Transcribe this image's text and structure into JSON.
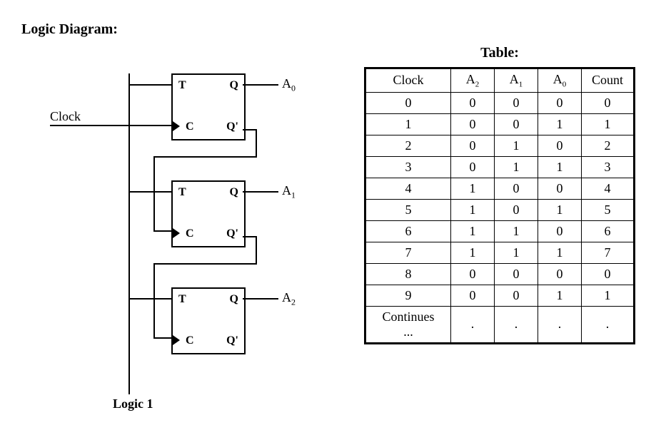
{
  "headings": {
    "diagram": "Logic Diagram:",
    "table": "Table:"
  },
  "diagram": {
    "clock_label": "Clock",
    "logic1_label": "Logic 1",
    "ff_pins": {
      "T": "T",
      "Q": "Q",
      "C": "C",
      "Qn": "Q'"
    },
    "outputs": {
      "A0": "A",
      "A0sub": "0",
      "A1": "A",
      "A1sub": "1",
      "A2": "A",
      "A2sub": "2"
    }
  },
  "table": {
    "headers": {
      "clock": "Clock",
      "A2": "A",
      "A2sub": "2",
      "A1": "A",
      "A1sub": "1",
      "A0": "A",
      "A0sub": "0",
      "count": "Count"
    },
    "rows": [
      {
        "clock": "0",
        "a2": "0",
        "a1": "0",
        "a0": "0",
        "count": "0"
      },
      {
        "clock": "1",
        "a2": "0",
        "a1": "0",
        "a0": "1",
        "count": "1"
      },
      {
        "clock": "2",
        "a2": "0",
        "a1": "1",
        "a0": "0",
        "count": "2"
      },
      {
        "clock": "3",
        "a2": "0",
        "a1": "1",
        "a0": "1",
        "count": "3"
      },
      {
        "clock": "4",
        "a2": "1",
        "a1": "0",
        "a0": "0",
        "count": "4"
      },
      {
        "clock": "5",
        "a2": "1",
        "a1": "0",
        "a0": "1",
        "count": "5"
      },
      {
        "clock": "6",
        "a2": "1",
        "a1": "1",
        "a0": "0",
        "count": "6"
      },
      {
        "clock": "7",
        "a2": "1",
        "a1": "1",
        "a0": "1",
        "count": "7"
      },
      {
        "clock": "8",
        "a2": "0",
        "a1": "0",
        "a0": "0",
        "count": "0"
      },
      {
        "clock": "9",
        "a2": "0",
        "a1": "0",
        "a0": "1",
        "count": "1"
      },
      {
        "clock": "Continues\n...",
        "a2": ".",
        "a1": ".",
        "a0": ".",
        "count": "."
      }
    ]
  },
  "chart_data": {
    "type": "table",
    "title": "3-bit asynchronous (ripple) counter truth table",
    "columns": [
      "Clock",
      "A2",
      "A1",
      "A0",
      "Count"
    ],
    "rows": [
      [
        0,
        0,
        0,
        0,
        0
      ],
      [
        1,
        0,
        0,
        1,
        1
      ],
      [
        2,
        0,
        1,
        0,
        2
      ],
      [
        3,
        0,
        1,
        1,
        3
      ],
      [
        4,
        1,
        0,
        0,
        4
      ],
      [
        5,
        1,
        0,
        1,
        5
      ],
      [
        6,
        1,
        1,
        0,
        6
      ],
      [
        7,
        1,
        1,
        1,
        7
      ],
      [
        8,
        0,
        0,
        0,
        0
      ],
      [
        9,
        0,
        0,
        1,
        1
      ]
    ],
    "note": "Continues..."
  }
}
